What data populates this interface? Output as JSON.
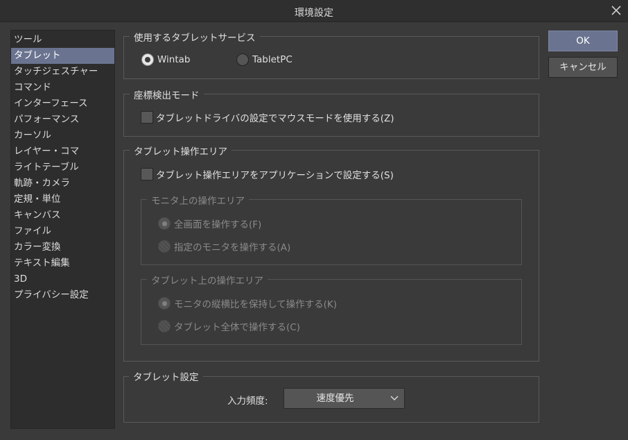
{
  "window": {
    "title": "環境設定"
  },
  "sidebar": {
    "items": [
      {
        "label": "ツール"
      },
      {
        "label": "タブレット",
        "selected": true
      },
      {
        "label": "タッチジェスチャー"
      },
      {
        "label": "コマンド"
      },
      {
        "label": "インターフェース"
      },
      {
        "label": "パフォーマンス"
      },
      {
        "label": "カーソル"
      },
      {
        "label": "レイヤー・コマ"
      },
      {
        "label": "ライトテーブル"
      },
      {
        "label": "軌跡・カメラ"
      },
      {
        "label": "定規・単位"
      },
      {
        "label": "キャンバス"
      },
      {
        "label": "ファイル"
      },
      {
        "label": "カラー変換"
      },
      {
        "label": "テキスト編集"
      },
      {
        "label": "3D"
      },
      {
        "label": "プライバシー設定"
      }
    ]
  },
  "service": {
    "legend": "使用するタブレットサービス",
    "options": [
      {
        "label": "Wintab",
        "checked": true
      },
      {
        "label": "TabletPC",
        "checked": false
      }
    ]
  },
  "coord_mode": {
    "legend": "座標検出モード",
    "checkbox_label": "タブレットドライバの設定でマウスモードを使用する(Z)",
    "checked": false
  },
  "operation_area": {
    "legend": "タブレット操作エリア",
    "checkbox_label": "タブレット操作エリアをアプリケーションで設定する(S)",
    "checked": false,
    "monitor": {
      "legend": "モニタ上の操作エリア",
      "options": [
        {
          "label": "全画面を操作する(F)",
          "checked": true
        },
        {
          "label": "指定のモニタを操作する(A)",
          "checked": false
        }
      ]
    },
    "tablet": {
      "legend": "タブレット上の操作エリア",
      "options": [
        {
          "label": "モニタの縦横比を保持して操作する(K)",
          "checked": true
        },
        {
          "label": "タブレット全体で操作する(C)",
          "checked": false
        }
      ]
    }
  },
  "tablet_settings": {
    "legend": "タブレット設定",
    "frequency_label": "入力頻度:",
    "frequency_value": "速度優先"
  },
  "buttons": {
    "ok": "OK",
    "cancel": "キャンセル"
  },
  "colors": {
    "accent": "#6a7490",
    "background": "#3a3a3a",
    "panel": "#2d2d2d"
  }
}
